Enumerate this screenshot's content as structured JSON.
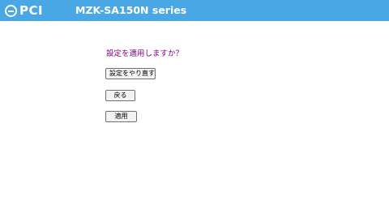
{
  "header": {
    "logo_text": "PCI",
    "model_title": "MZK-SA150N series",
    "background_color": "#4aa7e6"
  },
  "main": {
    "question": "設定を適用しますか？",
    "question_color": "#800080",
    "buttons": {
      "redo_label": "設定をやり直す",
      "back_label": "戻る",
      "apply_label": "適用"
    }
  }
}
